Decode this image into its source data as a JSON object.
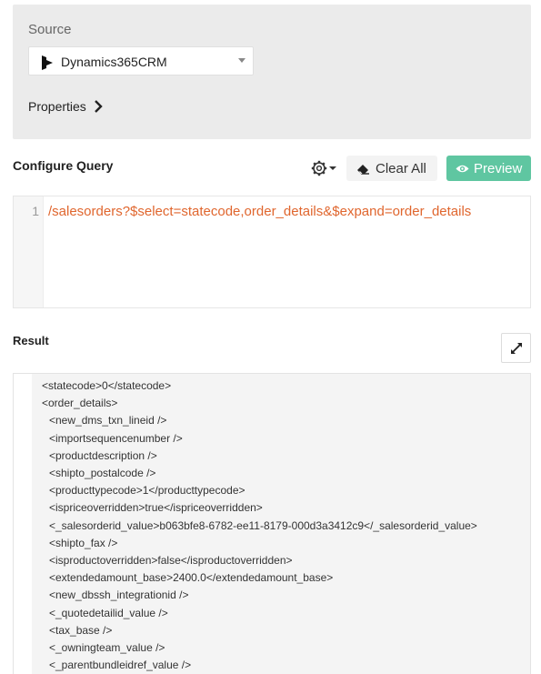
{
  "source": {
    "label": "Source",
    "selected": "Dynamics365CRM",
    "properties_label": "Properties"
  },
  "configure_query": {
    "title": "Configure Query",
    "clear_all_label": "Clear All",
    "preview_label": "Preview"
  },
  "editor": {
    "line_number": "1",
    "query": "/salesorders?$select=statecode,order_details&$expand=order_details"
  },
  "result": {
    "title": "Result",
    "lines": [
      {
        "indent": 0,
        "text": "<statecode>0</statecode>"
      },
      {
        "indent": 0,
        "text": "<order_details>"
      },
      {
        "indent": 1,
        "text": "<new_dms_txn_lineid />"
      },
      {
        "indent": 1,
        "text": "<importsequencenumber />"
      },
      {
        "indent": 1,
        "text": "<productdescription />"
      },
      {
        "indent": 1,
        "text": "<shipto_postalcode />"
      },
      {
        "indent": 1,
        "text": "<producttypecode>1</producttypecode>"
      },
      {
        "indent": 1,
        "text": "<ispriceoverridden>true</ispriceoverridden>"
      },
      {
        "indent": 1,
        "text": "<_salesorderid_value>b063bfe8-6782-ee11-8179-000d3a3412c9</_salesorderid_value>"
      },
      {
        "indent": 1,
        "text": "<shipto_fax />"
      },
      {
        "indent": 1,
        "text": "<isproductoverridden>false</isproductoverridden>"
      },
      {
        "indent": 1,
        "text": "<extendedamount_base>2400.0</extendedamount_base>"
      },
      {
        "indent": 1,
        "text": "<new_dbssh_integrationid />"
      },
      {
        "indent": 1,
        "text": "<_quotedetailid_value />"
      },
      {
        "indent": 1,
        "text": "<tax_base />"
      },
      {
        "indent": 1,
        "text": "<_owningteam_value />"
      },
      {
        "indent": 1,
        "text": "<_parentbundleidref_value />"
      }
    ]
  },
  "colors": {
    "panel_bg": "#ebebeb",
    "preview_green": "#5fc6a1",
    "query_orange": "#e0662e"
  },
  "icons": {
    "source_icon": "dynamics365-icon",
    "properties_icon": "chevron-right-icon",
    "settings_icon": "gear-icon",
    "clear_icon": "eraser-icon",
    "preview_icon": "eye-icon",
    "expand_icon": "expand-icon"
  }
}
